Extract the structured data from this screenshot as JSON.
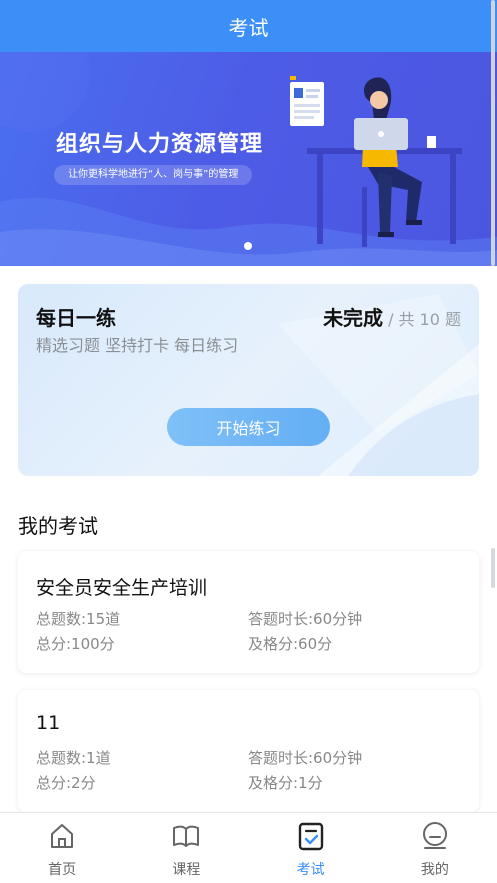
{
  "header": {
    "title": "考试"
  },
  "banner": {
    "title": "组织与人力资源管理",
    "subtitle": "让你更科学地进行“人、岗与事”的管理"
  },
  "daily_practice": {
    "title": "每日一练",
    "subtitle": "精选习题 坚持打卡 每日练习",
    "status": "未完成",
    "separator": "/",
    "total": "共 10 题",
    "button_label": "开始练习"
  },
  "my_exams": {
    "title": "我的考试",
    "items": [
      {
        "name": "安全员安全生产培训",
        "question_count": "总题数:15道",
        "duration": "答题时长:60分钟",
        "total_score": "总分:100分",
        "pass_score": "及格分:60分"
      },
      {
        "name": "11",
        "question_count": "总题数:1道",
        "duration": "答题时长:60分钟",
        "total_score": "总分:2分",
        "pass_score": "及格分:1分"
      }
    ]
  },
  "tabbar": {
    "items": [
      {
        "label": "首页",
        "icon": "home-icon"
      },
      {
        "label": "课程",
        "icon": "book-icon"
      },
      {
        "label": "考试",
        "icon": "exam-icon",
        "active": true
      },
      {
        "label": "我的",
        "icon": "profile-icon"
      }
    ]
  },
  "colors": {
    "primary": "#3b8ff6",
    "banner": "#4d5ce6",
    "accent_yellow": "#f6b800"
  }
}
